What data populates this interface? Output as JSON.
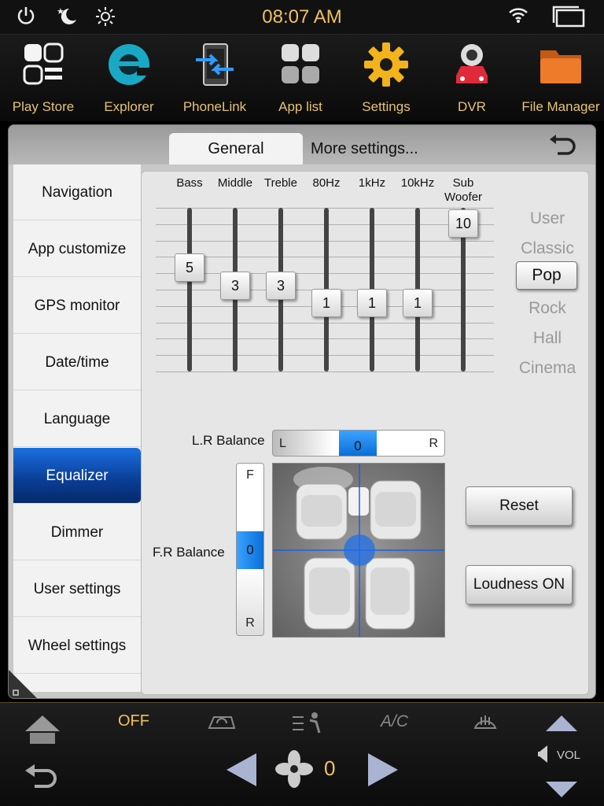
{
  "status": {
    "time": "08:07 AM",
    "icons": [
      "power-icon",
      "night-mode-icon",
      "brightness-icon",
      "wifi-icon",
      "window-icon"
    ]
  },
  "apps": [
    {
      "label": "Play Store",
      "icon": "apps-grid-icon"
    },
    {
      "label": "Explorer",
      "icon": "browser-icon"
    },
    {
      "label": "PhoneLink",
      "icon": "phonelink-icon"
    },
    {
      "label": "App list",
      "icon": "app-list-icon"
    },
    {
      "label": "Settings",
      "icon": "gear-icon"
    },
    {
      "label": "DVR",
      "icon": "dvr-icon"
    },
    {
      "label": "File Manager",
      "icon": "folder-icon"
    }
  ],
  "tabs": {
    "general": "General",
    "more": "More settings..."
  },
  "menu": [
    "Navigation",
    "App customize",
    "GPS monitor",
    "Date/time",
    "Language",
    "Equalizer",
    "Dimmer",
    "User settings",
    "Wheel settings"
  ],
  "menu_active": "Equalizer",
  "eq": {
    "bands": [
      {
        "label": "Bass",
        "value": "5",
        "level": 5
      },
      {
        "label": "Middle",
        "value": "3",
        "level": 3
      },
      {
        "label": "Treble",
        "value": "3",
        "level": 3
      },
      {
        "label": "80Hz",
        "value": "1",
        "level": 1
      },
      {
        "label": "1kHz",
        "value": "1",
        "level": 1
      },
      {
        "label": "10kHz",
        "value": "1",
        "level": 1
      },
      {
        "label": "Sub\nWoofer",
        "value": "10",
        "level": 10
      }
    ],
    "presets": [
      "User",
      "Classic",
      "Pop",
      "Rock",
      "Hall",
      "Cinema"
    ],
    "selected_preset": "Pop"
  },
  "balance": {
    "lr_label": "L.R Balance",
    "lr_left": "L",
    "lr_right": "R",
    "lr_value": "0",
    "fr_label": "F.R Balance",
    "fr_front": "F",
    "fr_rear": "R",
    "fr_value": "0"
  },
  "buttons": {
    "reset": "Reset",
    "loudness": "Loudness ON"
  },
  "bottom": {
    "off": "OFF",
    "ac": "A/C",
    "fan_speed": "0",
    "vol": "VOL"
  },
  "colors": {
    "accent": "#f0c15a",
    "active_blue": "#0a4fb4",
    "knob_blue": "#2e95ff"
  }
}
